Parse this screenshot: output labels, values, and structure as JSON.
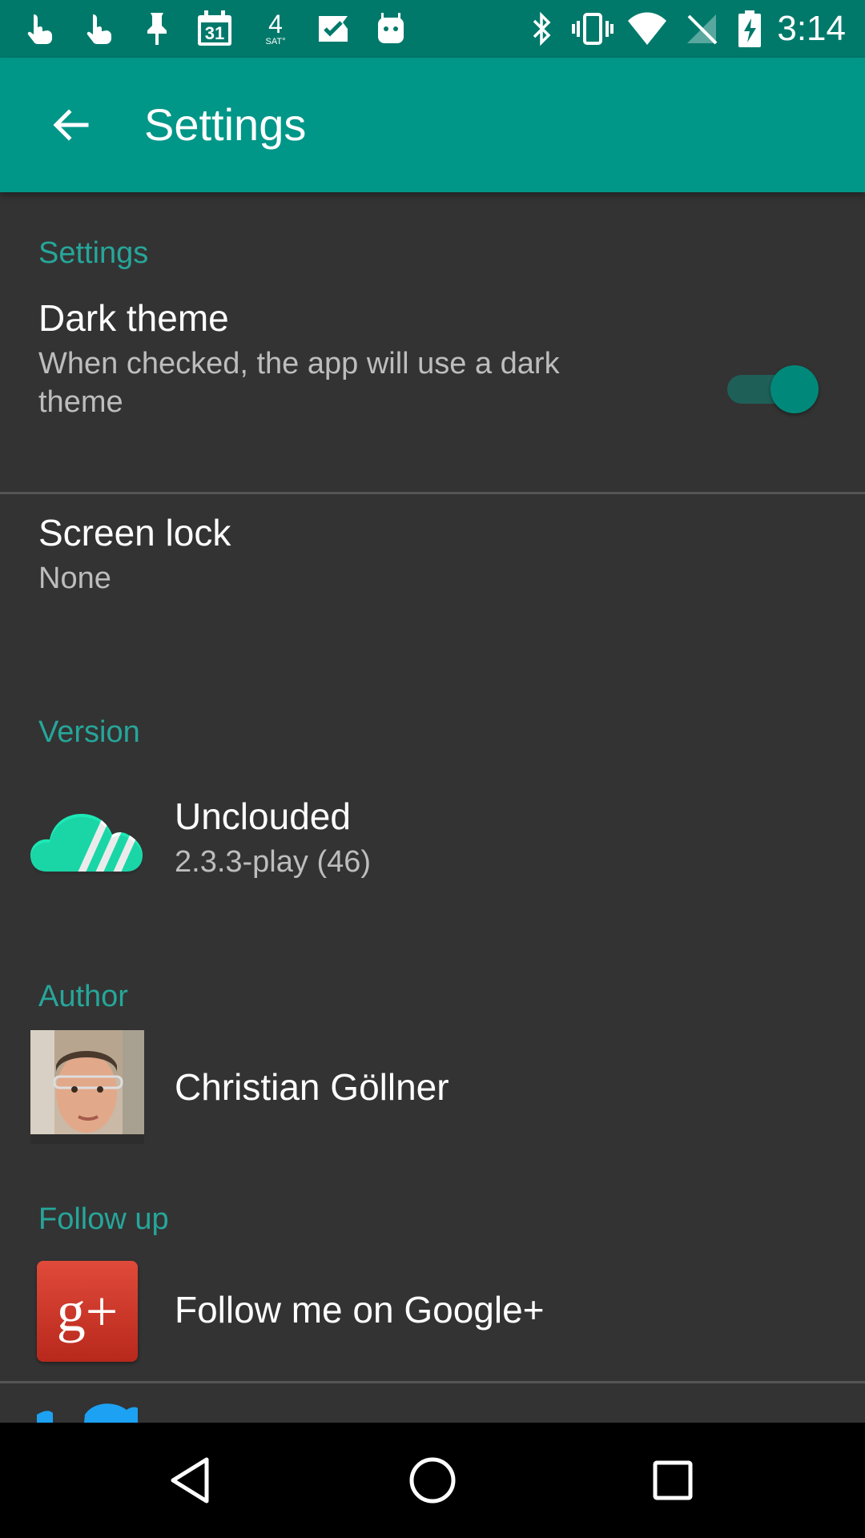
{
  "status_bar": {
    "time": "3:14",
    "calendar_day": "31",
    "weather_temp": "4",
    "weather_day": "SAT°",
    "left_icons": [
      "touch-icon",
      "touch-icon",
      "pin-icon",
      "calendar-icon",
      "weather-icon",
      "check-icon",
      "android-icon"
    ],
    "right_icons": [
      "bluetooth-icon",
      "vibrate-icon",
      "wifi-icon",
      "no-signal-icon",
      "battery-charging-icon"
    ]
  },
  "app_bar": {
    "title": "Settings",
    "back_icon": "arrow-back-icon",
    "color": "#009688"
  },
  "sections": {
    "settings": {
      "header": "Settings",
      "dark_theme": {
        "title": "Dark theme",
        "summary_line1": "When checked, the app will use a dark",
        "summary_line2": "theme",
        "checked": true
      },
      "screen_lock": {
        "title": "Screen lock",
        "summary": "None"
      }
    },
    "version": {
      "header": "Version",
      "app_name": "Unclouded",
      "version": "2.3.3-play (46)",
      "icon": "cloud-logo-icon"
    },
    "author": {
      "header": "Author",
      "name": "Christian Göllner",
      "icon": "avatar"
    },
    "follow_up": {
      "header": "Follow up",
      "google_plus": "Follow me on Google+",
      "google_plus_glyph": "g+",
      "icon": "google-plus-icon"
    }
  },
  "nav_bar": {
    "back": "nav-back-icon",
    "home": "nav-home-icon",
    "recents": "nav-recents-icon"
  },
  "colors": {
    "accent": "#26a69a",
    "background": "#333333",
    "toolbar": "#009688",
    "status_bar": "#00796b"
  }
}
